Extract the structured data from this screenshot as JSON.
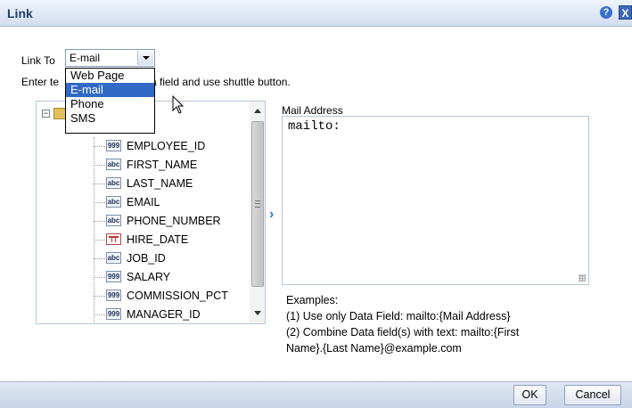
{
  "dialog": {
    "title": "Link",
    "help_icon": "?",
    "close_icon": "X"
  },
  "link_to": {
    "label": "Link To",
    "selected": "E-mail",
    "options": [
      "Web Page",
      "E-mail",
      "Phone",
      "SMS"
    ]
  },
  "instructions": {
    "visible_start": "Enter te",
    "visible_end": "a field and use shuttle button."
  },
  "tree": {
    "items": [
      {
        "type": "number",
        "icon": "999",
        "label": "EMPLOYEE_ID"
      },
      {
        "type": "text",
        "icon": "abc",
        "label": "FIRST_NAME"
      },
      {
        "type": "text",
        "icon": "abc",
        "label": "LAST_NAME"
      },
      {
        "type": "text",
        "icon": "abc",
        "label": "EMAIL"
      },
      {
        "type": "text",
        "icon": "abc",
        "label": "PHONE_NUMBER"
      },
      {
        "type": "date",
        "icon": "",
        "label": "HIRE_DATE"
      },
      {
        "type": "text",
        "icon": "abc",
        "label": "JOB_ID"
      },
      {
        "type": "number",
        "icon": "999",
        "label": "SALARY"
      },
      {
        "type": "number",
        "icon": "999",
        "label": "COMMISSION_PCT"
      },
      {
        "type": "number",
        "icon": "999",
        "label": "MANAGER_ID"
      }
    ]
  },
  "shuttle_glyph": "›",
  "mail_address": {
    "label": "Mail Address",
    "value": "mailto:"
  },
  "examples": {
    "heading": "Examples:",
    "line1": "(1) Use only Data Field: mailto:{Mail Address}",
    "line2": "(2) Combine Data field(s) with text: mailto:{First",
    "line3": "Name}.{Last Name}@example.com"
  },
  "buttons": {
    "ok": "OK",
    "cancel": "Cancel"
  }
}
